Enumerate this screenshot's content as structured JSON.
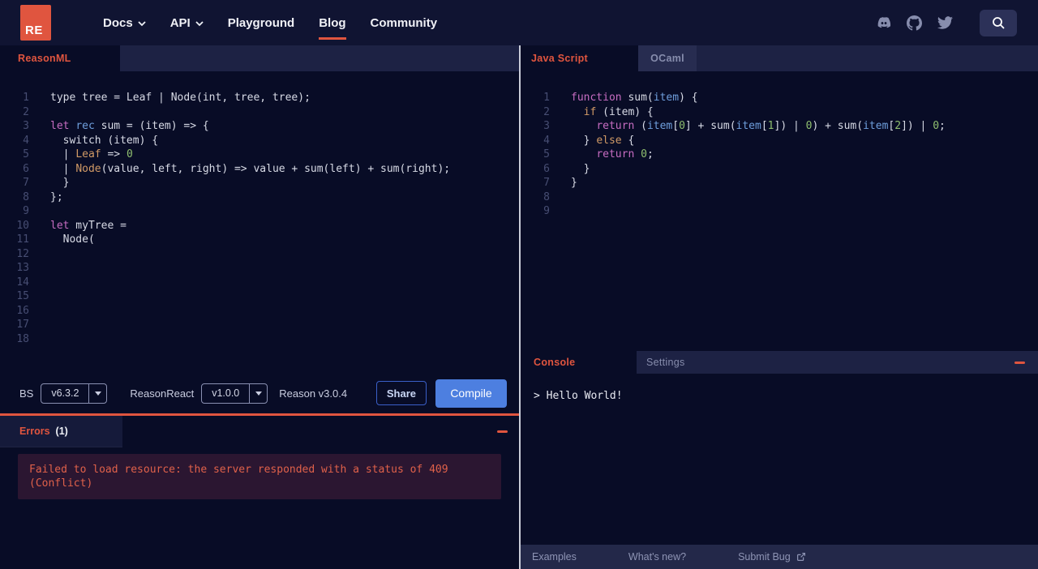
{
  "colors": {
    "accent": "#e0553f",
    "compile_blue": "#4d7fe0"
  },
  "nav": {
    "logo_text": "RE",
    "items": [
      {
        "label": "Docs",
        "chevron": true,
        "active": false
      },
      {
        "label": "API",
        "chevron": true,
        "active": false
      },
      {
        "label": "Playground",
        "chevron": false,
        "active": false
      },
      {
        "label": "Blog",
        "chevron": false,
        "active": true
      },
      {
        "label": "Community",
        "chevron": false,
        "active": false
      }
    ],
    "icons": [
      "discord-icon",
      "github-icon",
      "twitter-icon",
      "search-icon"
    ]
  },
  "left_pane": {
    "tab_label": "ReasonML",
    "code_lines": [
      [
        [
          "p",
          "type tree = Leaf | Node(int, tree, tree);"
        ]
      ],
      [],
      [
        [
          "k",
          "let"
        ],
        [
          "p",
          " "
        ],
        [
          "b",
          "rec"
        ],
        [
          "p",
          " sum = (item) => {"
        ]
      ],
      [
        [
          "p",
          "  switch (item) {"
        ]
      ],
      [
        [
          "p",
          "  | "
        ],
        [
          "o",
          "Leaf"
        ],
        [
          "p",
          " => "
        ],
        [
          "g",
          "0"
        ]
      ],
      [
        [
          "p",
          "  | "
        ],
        [
          "o",
          "Node"
        ],
        [
          "p",
          "(value, left, right) => value + sum(left) + sum(right);"
        ]
      ],
      [
        [
          "p",
          "  }"
        ]
      ],
      [
        [
          "p",
          "};"
        ]
      ],
      [],
      [
        [
          "k",
          "let"
        ],
        [
          "p",
          " myTree ="
        ]
      ],
      [
        [
          "p",
          "  Node("
        ]
      ],
      [],
      [],
      [],
      [],
      [],
      [],
      []
    ]
  },
  "toolbar": {
    "bs_label": "BS",
    "bs_version": "v6.3.2",
    "reason_react_label": "ReasonReact",
    "reason_react_version": "v1.0.0",
    "reason_version": "Reason v3.0.4",
    "share_label": "Share",
    "compile_label": "Compile"
  },
  "errors": {
    "title": "Errors",
    "count": "(1)",
    "message": "Failed to load resource: the server responded with a status of 409 (Conflict)"
  },
  "right_pane": {
    "tabs": [
      {
        "label": "Java Script",
        "active": true
      },
      {
        "label": "OCaml",
        "active": false
      }
    ],
    "code_lines": [
      [
        [
          "k",
          "function"
        ],
        [
          "p",
          " sum("
        ],
        [
          "b",
          "item"
        ],
        [
          "p",
          ") {"
        ]
      ],
      [
        [
          "p",
          "  "
        ],
        [
          "o",
          "if"
        ],
        [
          "p",
          " (item) {"
        ]
      ],
      [
        [
          "p",
          "    "
        ],
        [
          "k",
          "return"
        ],
        [
          "p",
          " ("
        ],
        [
          "b",
          "item"
        ],
        [
          "p",
          "["
        ],
        [
          "g",
          "0"
        ],
        [
          "p",
          "] + sum("
        ],
        [
          "b",
          "item"
        ],
        [
          "p",
          "["
        ],
        [
          "g",
          "1"
        ],
        [
          "p",
          "]) | "
        ],
        [
          "g",
          "0"
        ],
        [
          "p",
          ") + sum("
        ],
        [
          "b",
          "item"
        ],
        [
          "p",
          "["
        ],
        [
          "g",
          "2"
        ],
        [
          "p",
          "]) | "
        ],
        [
          "g",
          "0"
        ],
        [
          "p",
          ";"
        ]
      ],
      [
        [
          "p",
          "  } "
        ],
        [
          "o",
          "else"
        ],
        [
          "p",
          " {"
        ]
      ],
      [
        [
          "p",
          "    "
        ],
        [
          "k",
          "return"
        ],
        [
          "p",
          " "
        ],
        [
          "g",
          "0"
        ],
        [
          "p",
          ";"
        ]
      ],
      [
        [
          "p",
          "  }"
        ]
      ],
      [
        [
          "p",
          "}"
        ]
      ],
      [],
      []
    ]
  },
  "console": {
    "tabs": [
      {
        "label": "Console",
        "active": true
      },
      {
        "label": "Settings",
        "active": false
      }
    ],
    "output": "> Hello World!"
  },
  "footer": {
    "items": [
      "Examples",
      "What's new?",
      "Submit Bug"
    ],
    "icons": [
      "external-link-icon"
    ]
  }
}
